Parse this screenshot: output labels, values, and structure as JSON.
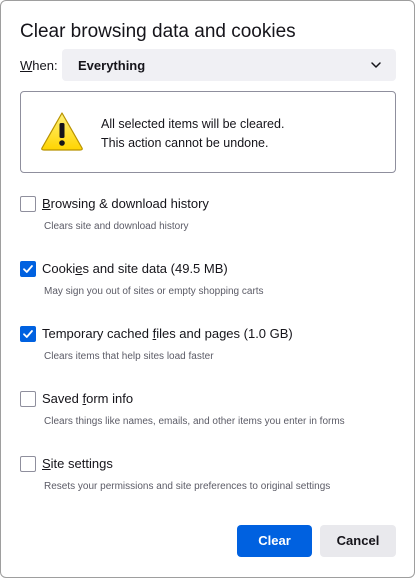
{
  "dialog": {
    "title": "Clear browsing data and cookies"
  },
  "when": {
    "label_mnemonic": "W",
    "label_rest": "hen:",
    "selected": "Everything",
    "icon": "chevron-down-icon"
  },
  "warning": {
    "icon": "warning-triangle-icon",
    "line1": "All selected items will be cleared.",
    "line2": "This action cannot be undone."
  },
  "options": [
    {
      "label_before": "",
      "label_mnemonic": "B",
      "label_after": "rowsing & download history",
      "description": "Clears site and download history",
      "checked": false
    },
    {
      "label_before": "Cooki",
      "label_mnemonic": "e",
      "label_after": "s and site data (49.5 MB)",
      "description": "May sign you out of sites or empty shopping carts",
      "checked": true
    },
    {
      "label_before": "Temporary cached ",
      "label_mnemonic": "f",
      "label_after": "iles and pages (1.0 GB)",
      "description": "Clears items that help sites load faster",
      "checked": true
    },
    {
      "label_before": "Saved ",
      "label_mnemonic": "f",
      "label_after": "orm info",
      "description": "Clears things like names, emails, and other items you enter in forms",
      "checked": false
    },
    {
      "label_before": "",
      "label_mnemonic": "S",
      "label_after": "ite settings",
      "description": "Resets your permissions and site preferences to original settings",
      "checked": false
    }
  ],
  "buttons": {
    "clear": "Clear",
    "cancel": "Cancel"
  },
  "colors": {
    "accent": "#0061e0",
    "warning_yellow": "#ffe900"
  }
}
